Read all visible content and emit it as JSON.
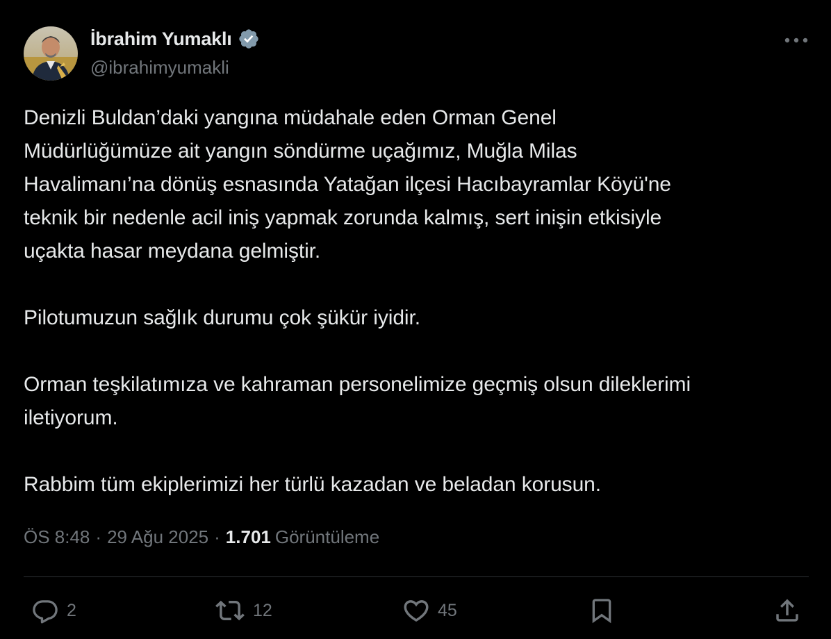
{
  "author": {
    "display_name": "İbrahim Yumaklı",
    "handle": "@ibrahimyumakli",
    "verified_icon": "verified-badge-icon",
    "avatar_icon": "profile-photo"
  },
  "tweet": {
    "paragraphs": [
      "Denizli Buldan’daki yangına müdahale eden Orman Genel\nMüdürlüğümüze ait yangın söndürme uçağımız, Muğla Milas\nHavalimanı’na dönüş esnasında Yatağan ilçesi Hacıbayramlar Köyü'ne\nteknik bir nedenle acil iniş yapmak zorunda kalmış, sert inişin etkisiyle\nuçakta hasar meydana gelmiştir.",
      "Pilotumuzun sağlık durumu çok şükür iyidir.",
      "Orman teşkilatımıza ve kahraman personelimize geçmiş olsun dileklerimi\niletiyorum.",
      "Rabbim tüm ekiplerimizi her türlü kazadan ve beladan korusun."
    ]
  },
  "meta": {
    "time": "ÖS 8:48",
    "separator": "·",
    "date": "29 Ağu 2025",
    "views_count": "1.701",
    "views_label": "Görüntüleme"
  },
  "actions": {
    "replies": "2",
    "reposts": "12",
    "likes": "45"
  },
  "colors": {
    "background": "#000000",
    "text": "#e7e9ea",
    "secondary": "#71767b",
    "divider": "#2f3336",
    "verified": "#829aab"
  }
}
